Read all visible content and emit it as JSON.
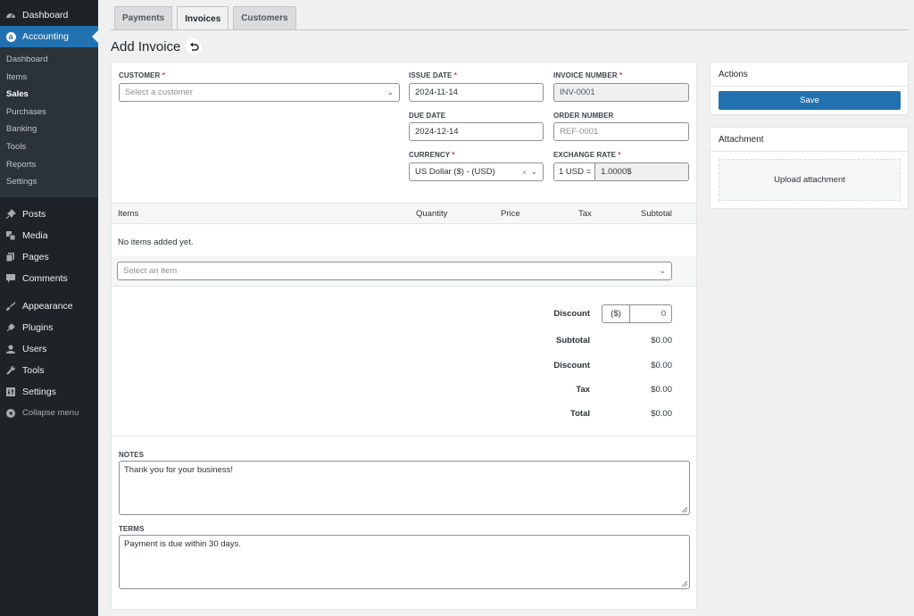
{
  "sidebar": {
    "top": [
      {
        "label": "Dashboard",
        "icon": "dashboard-icon"
      },
      {
        "label": "Accounting",
        "icon": "accounting-icon",
        "active": true
      }
    ],
    "submenu": [
      "Dashboard",
      "Items",
      "Sales",
      "Purchases",
      "Banking",
      "Tools",
      "Reports",
      "Settings"
    ],
    "submenu_current": "Sales",
    "group1": [
      {
        "label": "Posts",
        "icon": "pin-icon"
      },
      {
        "label": "Media",
        "icon": "media-icon"
      },
      {
        "label": "Pages",
        "icon": "pages-icon"
      },
      {
        "label": "Comments",
        "icon": "comment-icon"
      }
    ],
    "group2": [
      {
        "label": "Appearance",
        "icon": "brush-icon"
      },
      {
        "label": "Plugins",
        "icon": "plugin-icon"
      },
      {
        "label": "Users",
        "icon": "user-icon"
      },
      {
        "label": "Tools",
        "icon": "wrench-icon"
      },
      {
        "label": "Settings",
        "icon": "settings-icon"
      }
    ],
    "collapse_label": "Collapse menu"
  },
  "tabs": [
    {
      "label": "Payments",
      "active": false
    },
    {
      "label": "Invoices",
      "active": true
    },
    {
      "label": "Customers",
      "active": false
    }
  ],
  "page_title": "Add Invoice",
  "form": {
    "customer": {
      "label": "CUSTOMER",
      "required": "*",
      "placeholder": "Select a customer"
    },
    "issue_date": {
      "label": "ISSUE DATE",
      "required": "*",
      "value": "2024-11-14"
    },
    "invoice_number": {
      "label": "INVOICE NUMBER",
      "required": "*",
      "value": "INV-0001"
    },
    "due_date": {
      "label": "DUE DATE",
      "value": "2024-12-14"
    },
    "order_number": {
      "label": "ORDER NUMBER",
      "placeholder": "REF-0001"
    },
    "currency": {
      "label": "CURRENCY",
      "required": "*",
      "value": "US Dollar ($) - (USD)"
    },
    "exchange_rate": {
      "label": "EXCHANGE RATE",
      "required": "*",
      "prefix": "1 USD =",
      "value": "1.0000$"
    }
  },
  "items": {
    "columns": [
      "Items",
      "Quantity",
      "Price",
      "Tax",
      "Subtotal"
    ],
    "empty_text": "No items added yet.",
    "select_placeholder": "Select an item"
  },
  "totals": {
    "discount_label": "Discount",
    "discount_unit": "($)",
    "discount_value": "0",
    "rows": [
      {
        "label": "Subtotal",
        "value": "$0.00"
      },
      {
        "label": "Discount",
        "value": "$0.00"
      },
      {
        "label": "Tax",
        "value": "$0.00"
      },
      {
        "label": "Total",
        "value": "$0.00"
      }
    ]
  },
  "notes": {
    "label": "NOTES",
    "value": "Thank you for your business!"
  },
  "terms": {
    "label": "TERMS",
    "value": "Payment is due within 30 days."
  },
  "actions": {
    "title": "Actions",
    "save_label": "Save"
  },
  "attachment": {
    "title": "Attachment",
    "upload_label": "Upload attachment"
  },
  "colors": {
    "accent": "#2271b1",
    "sidebar": "#1d2327",
    "required": "#d63638"
  }
}
